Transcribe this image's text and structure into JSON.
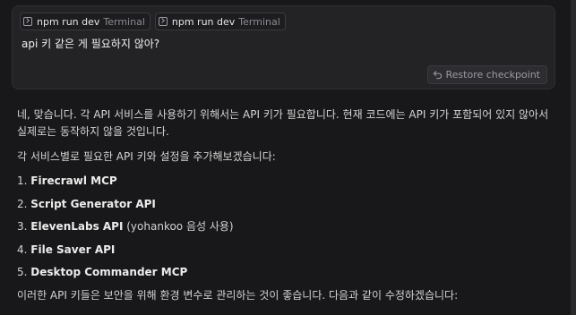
{
  "chips": [
    {
      "command": "npm run dev",
      "kind": "Terminal"
    },
    {
      "command": "npm run dev",
      "kind": "Terminal"
    }
  ],
  "user_message": "api 키 같은 게 필요하지 않아?",
  "restore_label": "Restore checkpoint",
  "assistant": {
    "para1": "네, 맞습니다. 각 API 서비스를 사용하기 위해서는 API 키가 필요합니다. 현재 코드에는 API 키가 포함되어 있지 않아서 실제로는 동작하지 않을 것입니다.",
    "para2": "각 서비스별로 필요한 API 키와 설정을 추가해보겠습니다:",
    "items": [
      {
        "num": "1.",
        "name": "Firecrawl MCP",
        "extra": ""
      },
      {
        "num": "2.",
        "name": "Script Generator API",
        "extra": ""
      },
      {
        "num": "3.",
        "name": "ElevenLabs API",
        "extra": " (yohankoo 음성 사용)"
      },
      {
        "num": "4.",
        "name": "File Saver API",
        "extra": ""
      },
      {
        "num": "5.",
        "name": "Desktop Commander MCP",
        "extra": ""
      }
    ],
    "para3": "이러한 API 키들은 보안을 위해 환경 변수로 관리하는 것이 좋습니다. 다음과 같이 수정하겠습니다:"
  }
}
